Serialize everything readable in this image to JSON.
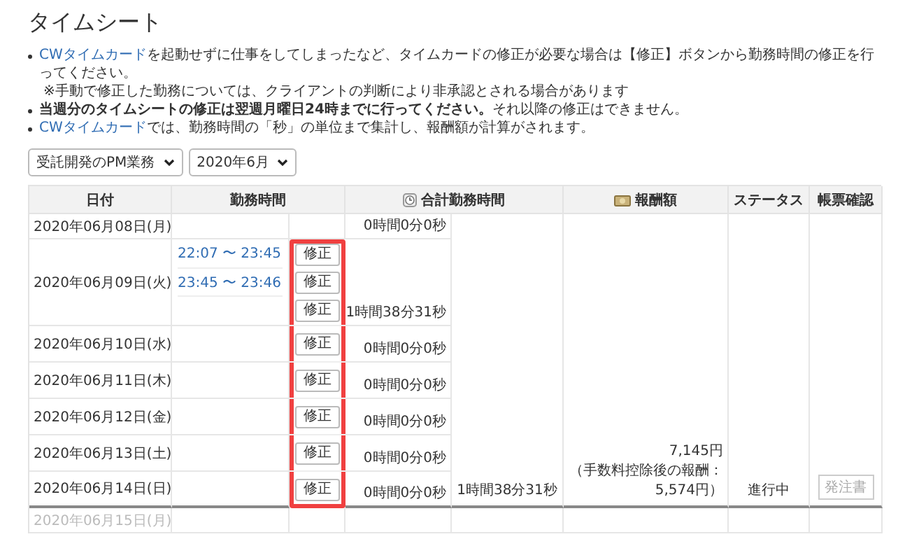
{
  "title": "タイムシート",
  "notes": [
    {
      "link": "CWタイムカード",
      "text": "を起動せずに仕事をしてしまったなど、タイムカードの修正が必要な場合は【修正】ボタンから勤務時間の修正を行ってください。",
      "sub": "※手動で修正した勤務については、クライアントの判断により非承認とされる場合があります"
    },
    {
      "text": "**当週分のタイムシートの修正は翌週月曜日24時までに行ってください。**それ以降の修正はできません。"
    },
    {
      "link": "CWタイムカード",
      "text": "では、勤務時間の「秒」の単位まで集計し、報酬額が計算がされます。"
    }
  ],
  "filters": [
    {
      "value": "受託開発のPM業務"
    },
    {
      "value": "2020年6月"
    }
  ],
  "columns": {
    "date": "日付",
    "work_time": "勤務時間",
    "total_time": "合計勤務時間",
    "reward": "報酬額",
    "status": "ステータス",
    "document": "帳票確認"
  },
  "edit_column_highlighted": true,
  "days": [
    {
      "date": "2020年06月08日(月)",
      "total": "0時間0分0秒",
      "week_end": false,
      "disabled": false
    },
    {
      "date": "2020年06月09日(火)",
      "entries": [
        {
          "time": "22:07 〜 23:45",
          "button": "修正"
        },
        {
          "time": "23:45 〜 23:46",
          "button": "修正"
        },
        {
          "button": "修正"
        }
      ],
      "total": "1時間38分31秒",
      "week_end": false,
      "disabled": false
    },
    {
      "date": "2020年06月10日(水)",
      "entries": [
        {
          "button": "修正"
        }
      ],
      "total": "0時間0分0秒",
      "week_end": false,
      "disabled": false
    },
    {
      "date": "2020年06月11日(木)",
      "entries": [
        {
          "button": "修正"
        }
      ],
      "total": "0時間0分0秒",
      "week_end": false,
      "disabled": false
    },
    {
      "date": "2020年06月12日(金)",
      "entries": [
        {
          "button": "修正"
        }
      ],
      "total": "0時間0分0秒",
      "week_end": false,
      "disabled": false
    },
    {
      "date": "2020年06月13日(土)",
      "entries": [
        {
          "button": "修正"
        }
      ],
      "total": "0時間0分0秒",
      "week_end": false,
      "disabled": false
    },
    {
      "date": "2020年06月14日(日)",
      "entries": [
        {
          "button": "修正"
        }
      ],
      "total": "0時間0分0秒",
      "week_end": true,
      "disabled": false
    },
    {
      "date": "2020年06月15日(月)",
      "week_end": false,
      "disabled": true
    }
  ],
  "week": {
    "total": "1時間38分31秒",
    "reward": "7,145円",
    "reward_note": "（手数料控除後の報酬：5,574円）",
    "status": "進行中",
    "document_button": {
      "label": "発注書",
      "disabled": true
    }
  }
}
